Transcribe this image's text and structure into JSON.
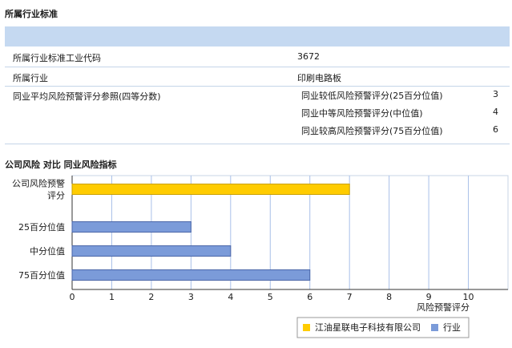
{
  "section1": {
    "title": "所属行业标准",
    "rows": [
      {
        "label": "所属行业标准工业代码",
        "value": "3672"
      },
      {
        "label": "所属行业",
        "value": "印刷电路板"
      }
    ],
    "ref_label": "同业平均风险预警评分参照(四等分数)",
    "ref_items": [
      {
        "label": "同业较低风险预警评分(25百分位值)",
        "value": "3"
      },
      {
        "label": "同业中等风险预警评分(中位值)",
        "value": "4"
      },
      {
        "label": "同业较高风险预警评分(75百分位值)",
        "value": "6"
      }
    ]
  },
  "section2": {
    "title": "公司风险 对比 同业风险指标"
  },
  "colors": {
    "company": "#ffcc00",
    "industry": "#7b9bd9",
    "grid": "#a8c0e8",
    "band": "#c5d9f1"
  },
  "chart_data": {
    "type": "bar",
    "orientation": "horizontal",
    "categories": [
      "公司风险预警\n评分",
      "25百分位值",
      "中分位值",
      "75百分位值"
    ],
    "values": [
      7,
      3,
      4,
      6
    ],
    "series": [
      {
        "name": "江油星联电子科技有限公司",
        "indices": [
          0
        ]
      },
      {
        "name": "行业",
        "indices": [
          1,
          2,
          3
        ]
      }
    ],
    "xlabel": "风险预警评分",
    "xlim": [
      0,
      11
    ],
    "xticks": [
      0,
      1,
      2,
      3,
      4,
      5,
      6,
      7,
      8,
      9,
      10
    ],
    "grid": true,
    "legend": "bottom-right"
  }
}
